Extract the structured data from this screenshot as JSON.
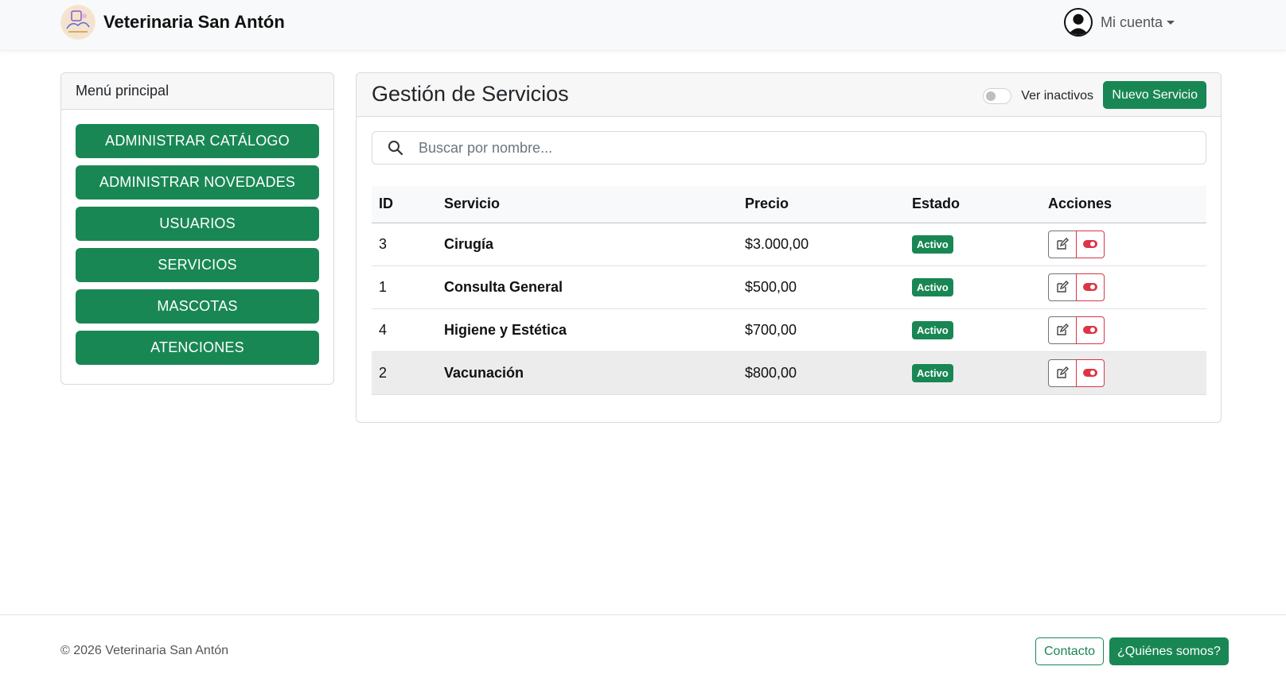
{
  "brand": {
    "name": "Veterinaria San Antón",
    "logo_icon": "pet-clinic-logo-icon"
  },
  "account": {
    "label": "Mi cuenta",
    "icon": "user-avatar-icon"
  },
  "sidebar": {
    "title": "Menú principal",
    "items": [
      {
        "label": "ADMINISTRAR CATÁLOGO"
      },
      {
        "label": "ADMINISTRAR NOVEDADES"
      },
      {
        "label": "USUARIOS"
      },
      {
        "label": "SERVICIOS"
      },
      {
        "label": "MASCOTAS"
      },
      {
        "label": "ATENCIONES"
      }
    ]
  },
  "main": {
    "title": "Gestión de Servicios",
    "toggle_label": "Ver inactivos",
    "toggle_on": false,
    "new_button": "Nuevo Servicio",
    "search": {
      "placeholder": "Buscar por nombre...",
      "value": ""
    },
    "table": {
      "headers": [
        "ID",
        "Servicio",
        "Precio",
        "Estado",
        "Acciones"
      ],
      "rows": [
        {
          "id": "3",
          "name": "Cirugía",
          "price": "$3.000,00",
          "status": "Activo"
        },
        {
          "id": "1",
          "name": "Consulta General",
          "price": "$500,00",
          "status": "Activo"
        },
        {
          "id": "4",
          "name": "Higiene y Estética",
          "price": "$700,00",
          "status": "Activo"
        },
        {
          "id": "2",
          "name": "Vacunación",
          "price": "$800,00",
          "status": "Activo"
        }
      ]
    }
  },
  "footer": {
    "copyright": "© 2026 Veterinaria San Antón",
    "contact": "Contacto",
    "about": "¿Quiénes somos?"
  },
  "colors": {
    "primary": "#198754",
    "danger": "#dc3545",
    "navbar_bg": "#f8f9fa"
  }
}
